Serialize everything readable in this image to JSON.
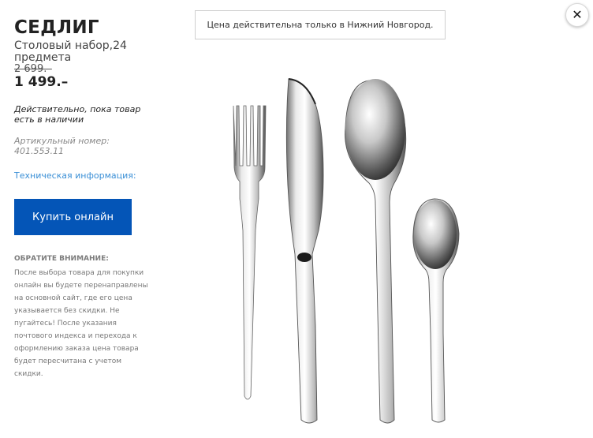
{
  "product": {
    "name": "СЕДЛИГ",
    "description": "Столовый набор,24 предмета",
    "old_price": "2 699.–",
    "price": "1 499.–",
    "validity": "Действительно, пока товар есть в наличии",
    "article": "Артикульный номер: 401.553.11",
    "tech_info_link": "Техническая информация:"
  },
  "buy_button": {
    "label": "Купить онлайн"
  },
  "notice": {
    "heading": "ОБРАТИТЕ ВНИМАНИЕ:",
    "body": "После выбора товара для покупки онлайн вы будете перенаправлены на основной сайт, где его цена указывается без скидки. Не пугайтесь! После указания почтового индекса и перехода к оформлению заказа цена товара будет пересчитана с учетом скидки."
  },
  "banner": {
    "text": "Цена действительна только в Нижний Новгород."
  },
  "close_icon": "close-icon",
  "colors": {
    "button": "#0455b7",
    "link": "#3a8fd6"
  }
}
